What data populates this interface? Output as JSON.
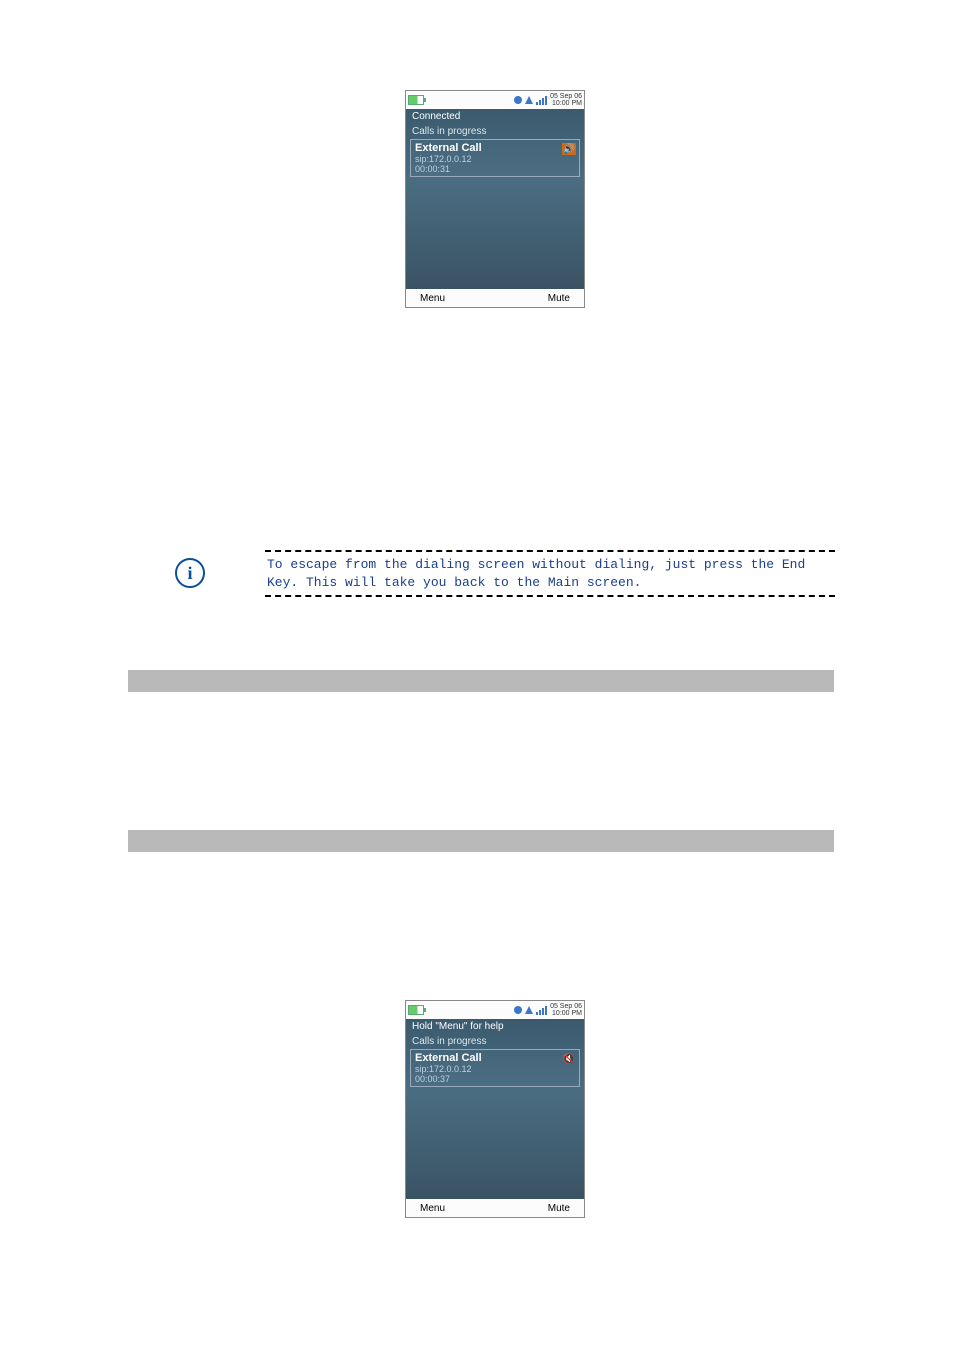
{
  "note": {
    "text": "To escape from the dialing screen without dialing, just press the End Key.  This will take you back to the Main screen."
  },
  "screens": {
    "a": {
      "status": {
        "date_line1": "05 Sep 06",
        "date_line2": "10:00 PM"
      },
      "line1": "Connected",
      "line2": "Calls in progress",
      "call": {
        "title": "External Call",
        "sip": "sip:172.0.0.12",
        "timer": "00:00:31",
        "icon_name": "speaker-active-icon"
      },
      "softkeys": {
        "left": "Menu",
        "right": "Mute"
      }
    },
    "b": {
      "status": {
        "date_line1": "05 Sep 06",
        "date_line2": "10:00 PM"
      },
      "line1": "Hold \"Menu\" for help",
      "line2": "Calls in progress",
      "call": {
        "title": "External Call",
        "sip": "sip:172.0.0.12",
        "timer": "00:00:37",
        "icon_name": "speaker-muted-icon"
      },
      "softkeys": {
        "left": "Menu",
        "right": "Mute"
      }
    }
  }
}
